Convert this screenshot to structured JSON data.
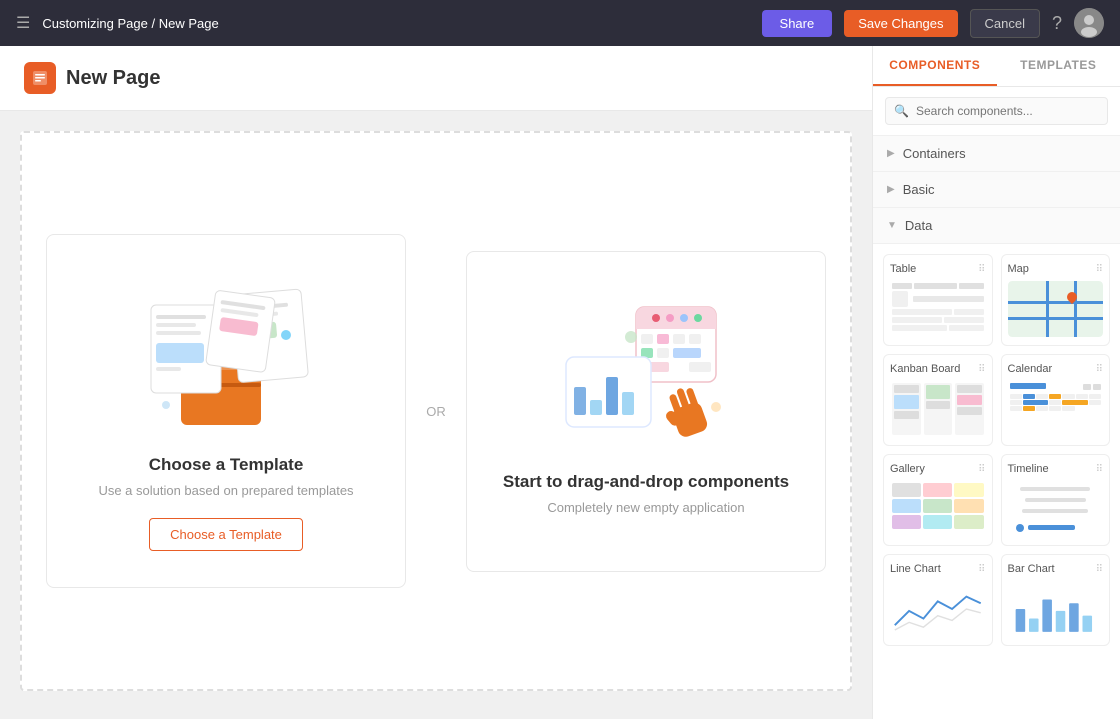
{
  "nav": {
    "menu_label": "Menu",
    "breadcrumb_parent": "Customizing Page",
    "breadcrumb_separator": "/",
    "breadcrumb_current": "New Page",
    "share_label": "Share",
    "save_changes_label": "Save Changes",
    "cancel_label": "Cancel",
    "help_label": "?",
    "avatar_label": "User Avatar"
  },
  "page": {
    "icon": "🔶",
    "title": "New Page"
  },
  "cards": {
    "template_card": {
      "title": "Choose a Template",
      "subtitle": "Use a solution based on prepared templates",
      "button_label": "Choose a Template"
    },
    "or_label": "OR",
    "dragdrop_card": {
      "title": "Start to drag-and-drop components",
      "subtitle": "Completely new empty application"
    }
  },
  "sidebar": {
    "tab_components": "Components",
    "tab_templates": "Templates",
    "search_placeholder": "Search components...",
    "sections": [
      {
        "id": "containers",
        "label": "Containers",
        "expanded": false
      },
      {
        "id": "basic",
        "label": "Basic",
        "expanded": false
      },
      {
        "id": "data",
        "label": "Data",
        "expanded": true
      }
    ],
    "components": [
      {
        "id": "table",
        "label": "Table"
      },
      {
        "id": "map",
        "label": "Map"
      },
      {
        "id": "kanban",
        "label": "Kanban Board"
      },
      {
        "id": "calendar",
        "label": "Calendar"
      },
      {
        "id": "gallery",
        "label": "Gallery"
      },
      {
        "id": "timeline",
        "label": "Timeline"
      },
      {
        "id": "line-chart",
        "label": "Line Chart"
      },
      {
        "id": "bar-chart",
        "label": "Bar Chart"
      }
    ]
  }
}
